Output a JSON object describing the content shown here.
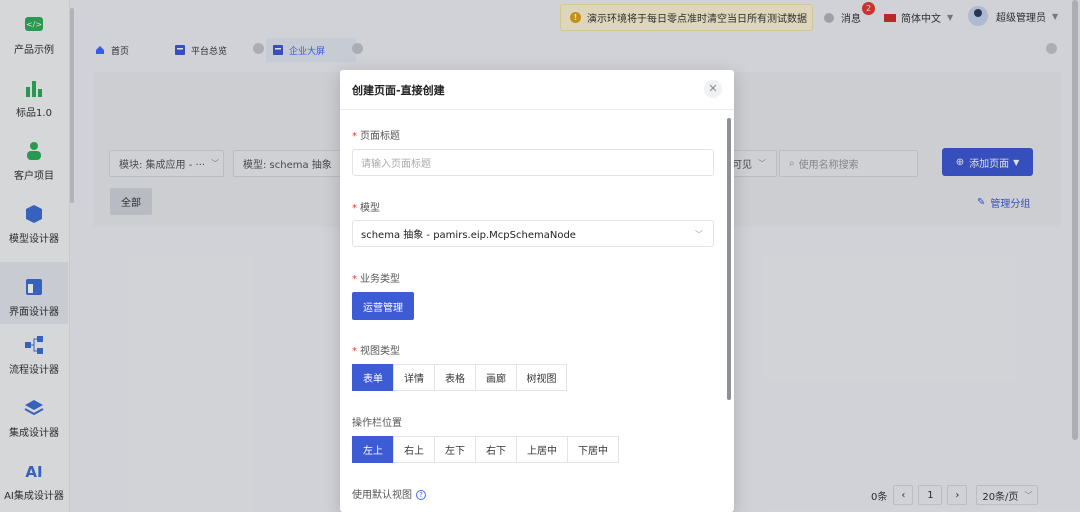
{
  "sidebar": {
    "items": [
      {
        "label": "产品示例",
        "icon": "code-icon"
      },
      {
        "label": "标品1.0",
        "icon": "bar-chart-icon"
      },
      {
        "label": "客户项目",
        "icon": "people-icon"
      },
      {
        "label": "模型设计器",
        "icon": "cube-icon"
      },
      {
        "label": "界面设计器",
        "icon": "layout-icon"
      },
      {
        "label": "流程设计器",
        "icon": "flow-icon"
      },
      {
        "label": "集成设计器",
        "icon": "layers-icon"
      },
      {
        "label": "AI集成设计器",
        "icon": "ai-icon"
      }
    ]
  },
  "topbar": {
    "notice": "演示环境将于每日零点准时清空当日所有测试数据",
    "messages_label": "消息",
    "messages_count": "2",
    "language": "简体中文",
    "user": "超级管理员"
  },
  "tabs": [
    {
      "label": "首页"
    },
    {
      "label": "平台总览"
    },
    {
      "label": "企业大屏"
    }
  ],
  "toolbar": {
    "module_filter": "模块: 集成应用 - ···",
    "model_filter": "模型: schema 抽象",
    "visible_filter": "可见",
    "search_placeholder": "使用名称搜索",
    "add_button": "添加页面",
    "all_chip": "全部",
    "manage_groups": "管理分组"
  },
  "pagination": {
    "total": "0条",
    "page": "1",
    "page_size": "20条/页"
  },
  "modal": {
    "title": "创建页面-直接创建",
    "fields": {
      "page_title_label": "页面标题",
      "page_title_placeholder": "请输入页面标题",
      "model_label": "模型",
      "model_value": "schema 抽象 - pamirs.eip.McpSchemaNode",
      "biz_type_label": "业务类型",
      "biz_type_value": "运营管理",
      "view_type_label": "视图类型",
      "view_types": [
        "表单",
        "详情",
        "表格",
        "画廊",
        "树视图"
      ],
      "toolbar_pos_label": "操作栏位置",
      "toolbar_positions": [
        "左上",
        "右上",
        "左下",
        "右下",
        "上居中",
        "下居中"
      ],
      "default_view_label": "使用默认视图"
    }
  },
  "colors": {
    "primary": "#3e5bd6",
    "notice_bg": "#fdf4d5",
    "badge": "#e53935"
  }
}
